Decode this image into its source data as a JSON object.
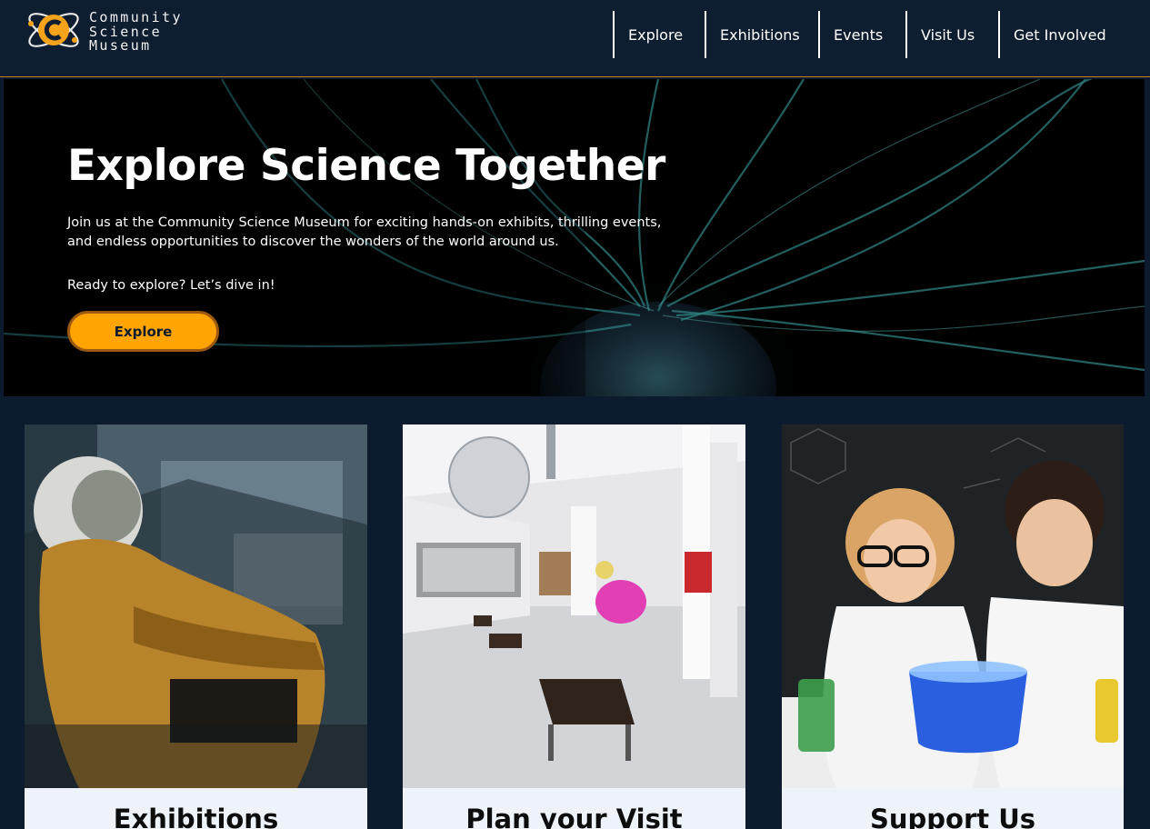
{
  "header": {
    "logo_lines": [
      "Community",
      "Science",
      "Museum"
    ],
    "nav": [
      "Explore",
      "Exhibitions",
      "Events",
      "Visit Us",
      "Get Involved"
    ]
  },
  "hero": {
    "title": "Explore Science Together",
    "description": "Join us at the Community Science Museum for exciting hands-on exhibits, thrilling events, and endless opportunities to discover the wonders of the world around us.",
    "cta_text": "Ready to explore? Let’s dive in!",
    "button_label": "Explore"
  },
  "cards": [
    {
      "title": "Exhibitions"
    },
    {
      "title": "Plan your Visit"
    },
    {
      "title": "Support Us"
    }
  ],
  "colors": {
    "background": "#0d1b2e",
    "accent": "#ffa400",
    "card": "#eef2f9"
  }
}
